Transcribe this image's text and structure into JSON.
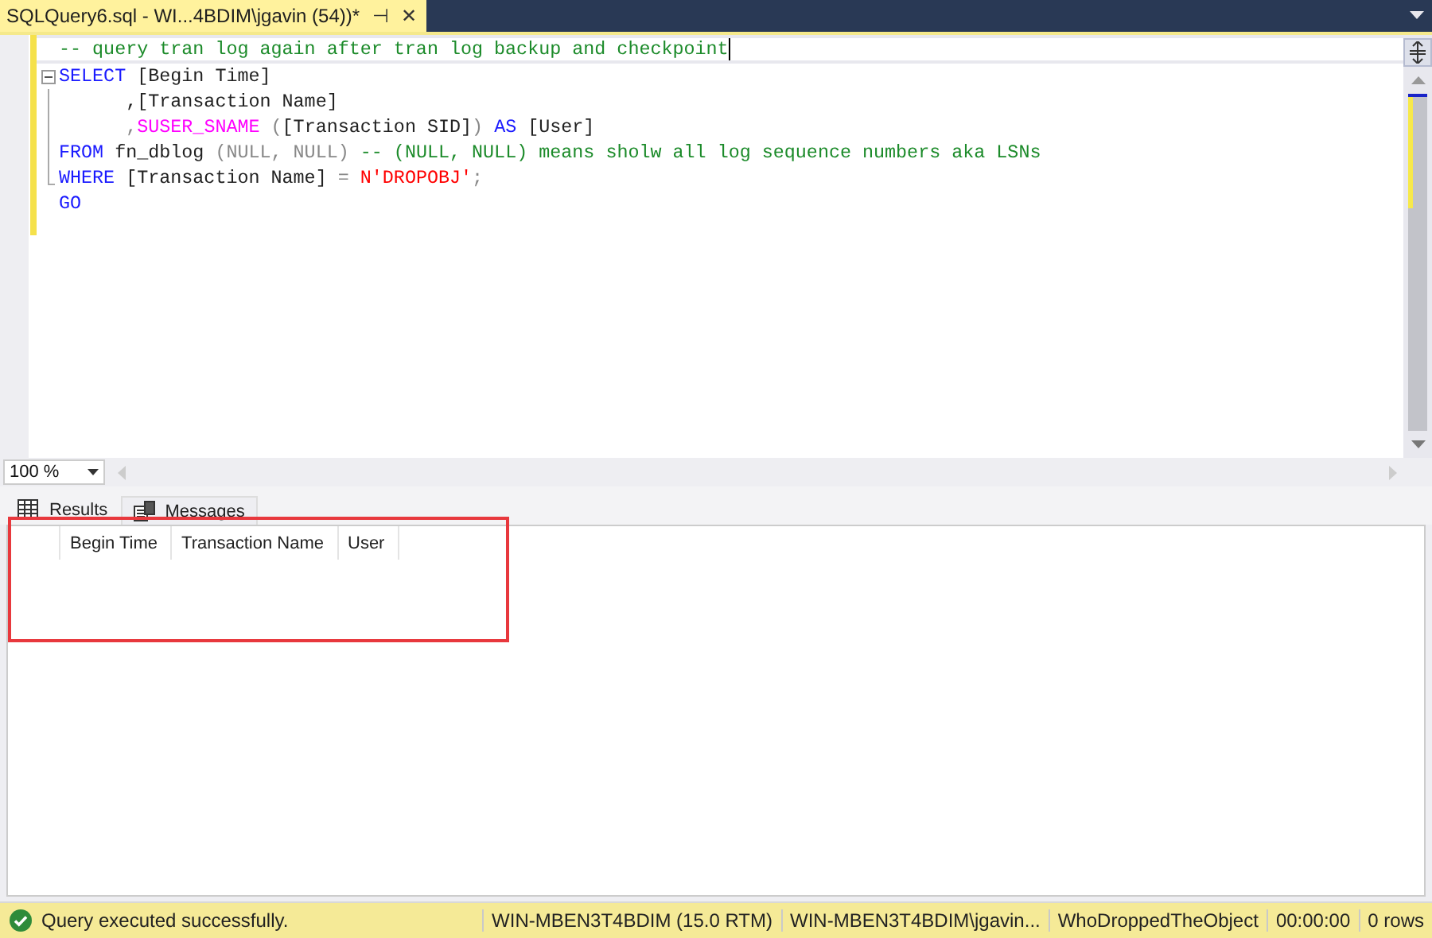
{
  "tabs": [
    {
      "label": "SQLQuery6.sql - WI...4BDIM\\jgavin (54))*",
      "pin": "⊣",
      "close": "✕",
      "selected": true
    }
  ],
  "editor": {
    "lines": [
      {
        "kind": "plain",
        "tokens": [
          {
            "kind": "comment",
            "text": "-- query tran log again after tran log backup and checkpoint"
          }
        ]
      },
      {
        "kind": "blockstart",
        "tokens": [
          {
            "kind": "keyword",
            "text": "SELECT"
          },
          {
            "kind": "plain",
            "text": " [Begin Time]"
          }
        ]
      },
      {
        "kind": "inblock",
        "tokens": [
          {
            "kind": "plain",
            "text": "      ,[Transaction Name]"
          }
        ]
      },
      {
        "kind": "inblock",
        "tokens": [
          {
            "kind": "gray",
            "text": "      ,"
          },
          {
            "kind": "function",
            "text": "SUSER_SNAME"
          },
          {
            "kind": "gray",
            "text": " ("
          },
          {
            "kind": "plain",
            "text": "[Transaction SID]"
          },
          {
            "kind": "gray",
            "text": ") "
          },
          {
            "kind": "keyword",
            "text": "AS"
          },
          {
            "kind": "plain",
            "text": " [User]"
          }
        ]
      },
      {
        "kind": "inblock",
        "tokens": [
          {
            "kind": "keyword",
            "text": "FROM"
          },
          {
            "kind": "plain",
            "text": " fn_dblog "
          },
          {
            "kind": "gray",
            "text": "(NULL, NULL) "
          },
          {
            "kind": "comment",
            "text": "-- (NULL, NULL) means sholw all log sequence numbers aka LSNs"
          }
        ]
      },
      {
        "kind": "blockend",
        "tokens": [
          {
            "kind": "keyword",
            "text": "WHERE"
          },
          {
            "kind": "plain",
            "text": " [Transaction Name] "
          },
          {
            "kind": "gray",
            "text": "= "
          },
          {
            "kind": "string",
            "text": "N'DROPOBJ'"
          },
          {
            "kind": "gray",
            "text": ";"
          }
        ]
      },
      {
        "kind": "plain",
        "tokens": [
          {
            "kind": "keyword",
            "text": "GO"
          }
        ]
      }
    ]
  },
  "zoom": {
    "value": "100 %"
  },
  "result_tabs": [
    {
      "label": "Results",
      "selected": true
    },
    {
      "label": "Messages",
      "selected": false
    }
  ],
  "grid": {
    "columns": [
      "Begin Time",
      "Transaction Name",
      "User"
    ]
  },
  "annotations": [
    {
      "kind": "rectangle"
    }
  ],
  "status_bar": {
    "message": "Query executed successfully.",
    "fields": [
      "WIN-MBEN3T4BDIM (15.0 RTM)",
      "WIN-MBEN3T4BDIM\\jgavin...",
      "WhoDroppedTheObject",
      "00:00:00",
      "0 rows"
    ]
  }
}
